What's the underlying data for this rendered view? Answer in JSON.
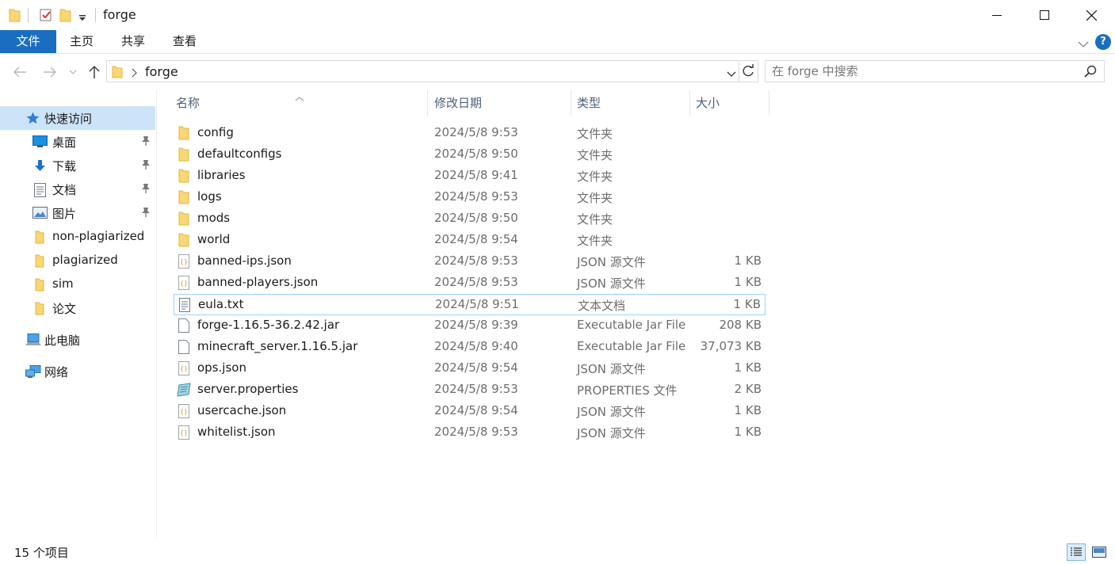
{
  "window": {
    "title": "forge",
    "minimize_icon": "minimize-icon",
    "maximize_icon": "maximize-icon",
    "close_icon": "close-icon"
  },
  "ribbon": {
    "tabs": [
      {
        "label": "文件"
      },
      {
        "label": "主页"
      },
      {
        "label": "共享"
      },
      {
        "label": "查看"
      }
    ],
    "help_label": "?"
  },
  "nav": {
    "path": "forge",
    "search_placeholder": "在 forge 中搜索"
  },
  "sidebar": {
    "items": [
      {
        "label": "快速访问",
        "icon": "star-icon"
      },
      {
        "label": "桌面",
        "icon": "desktop-icon",
        "pinned": true
      },
      {
        "label": "下载",
        "icon": "download-icon",
        "pinned": true
      },
      {
        "label": "文档",
        "icon": "document-icon",
        "pinned": true
      },
      {
        "label": "图片",
        "icon": "picture-icon",
        "pinned": true
      },
      {
        "label": "non-plagiarized",
        "icon": "folder-icon"
      },
      {
        "label": "plagiarized",
        "icon": "folder-icon"
      },
      {
        "label": "sim",
        "icon": "folder-icon"
      },
      {
        "label": "论文",
        "icon": "folder-icon"
      },
      {
        "label": "此电脑",
        "icon": "computer-icon"
      },
      {
        "label": "网络",
        "icon": "network-icon"
      }
    ]
  },
  "columns": {
    "name": "名称",
    "date": "修改日期",
    "type": "类型",
    "size": "大小"
  },
  "files": [
    {
      "name": "config",
      "date": "2024/5/8 9:53",
      "type": "文件夹",
      "size": "",
      "icon": "folder-icon"
    },
    {
      "name": "defaultconfigs",
      "date": "2024/5/8 9:50",
      "type": "文件夹",
      "size": "",
      "icon": "folder-icon"
    },
    {
      "name": "libraries",
      "date": "2024/5/8 9:41",
      "type": "文件夹",
      "size": "",
      "icon": "folder-icon"
    },
    {
      "name": "logs",
      "date": "2024/5/8 9:53",
      "type": "文件夹",
      "size": "",
      "icon": "folder-icon"
    },
    {
      "name": "mods",
      "date": "2024/5/8 9:50",
      "type": "文件夹",
      "size": "",
      "icon": "folder-icon"
    },
    {
      "name": "world",
      "date": "2024/5/8 9:54",
      "type": "文件夹",
      "size": "",
      "icon": "folder-icon"
    },
    {
      "name": "banned-ips.json",
      "date": "2024/5/8 9:53",
      "type": "JSON 源文件",
      "size": "1 KB",
      "icon": "json-file-icon"
    },
    {
      "name": "banned-players.json",
      "date": "2024/5/8 9:53",
      "type": "JSON 源文件",
      "size": "1 KB",
      "icon": "json-file-icon"
    },
    {
      "name": "eula.txt",
      "date": "2024/5/8 9:51",
      "type": "文本文档",
      "size": "1 KB",
      "icon": "text-file-icon"
    },
    {
      "name": "forge-1.16.5-36.2.42.jar",
      "date": "2024/5/8 9:39",
      "type": "Executable Jar File",
      "size": "208 KB",
      "icon": "file-icon"
    },
    {
      "name": "minecraft_server.1.16.5.jar",
      "date": "2024/5/8 9:40",
      "type": "Executable Jar File",
      "size": "37,073 KB",
      "icon": "file-icon"
    },
    {
      "name": "ops.json",
      "date": "2024/5/8 9:54",
      "type": "JSON 源文件",
      "size": "1 KB",
      "icon": "json-file-icon"
    },
    {
      "name": "server.properties",
      "date": "2024/5/8 9:53",
      "type": "PROPERTIES 文件",
      "size": "2 KB",
      "icon": "properties-file-icon"
    },
    {
      "name": "usercache.json",
      "date": "2024/5/8 9:54",
      "type": "JSON 源文件",
      "size": "1 KB",
      "icon": "json-file-icon"
    },
    {
      "name": "whitelist.json",
      "date": "2024/5/8 9:53",
      "type": "JSON 源文件",
      "size": "1 KB",
      "icon": "json-file-icon"
    }
  ],
  "status": {
    "item_count": "15 个项目"
  },
  "colors": {
    "accent": "#1a6ec2",
    "selected": "#cce4f7",
    "folder": "#f8d775",
    "folder_dark": "#e6b53c"
  }
}
